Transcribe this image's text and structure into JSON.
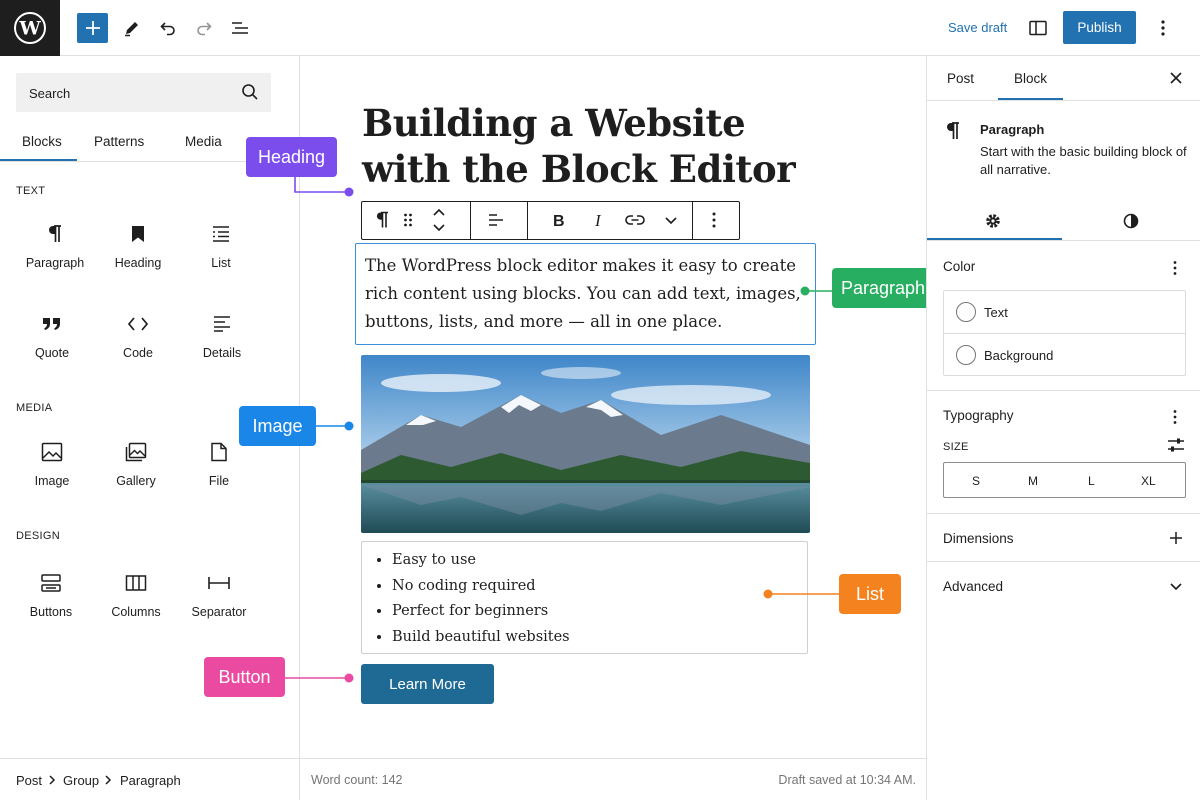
{
  "toolbar": {
    "save_draft": "Save draft",
    "publish": "Publish"
  },
  "inserter": {
    "search_placeholder": "Search",
    "tabs": [
      "Blocks",
      "Patterns",
      "Media"
    ],
    "categories": {
      "text": {
        "label": "TEXT",
        "blocks": [
          {
            "label": "Paragraph",
            "icon": "pilcrow-icon"
          },
          {
            "label": "Heading",
            "icon": "bookmark-icon"
          },
          {
            "label": "List",
            "icon": "list-icon"
          },
          {
            "label": "Quote",
            "icon": "quote-icon"
          },
          {
            "label": "Code",
            "icon": "code-icon"
          },
          {
            "label": "Details",
            "icon": "details-icon"
          }
        ]
      },
      "media": {
        "label": "MEDIA",
        "blocks": [
          {
            "label": "Image",
            "icon": "image-icon"
          },
          {
            "label": "Gallery",
            "icon": "gallery-icon"
          },
          {
            "label": "File",
            "icon": "file-icon"
          }
        ]
      },
      "design": {
        "label": "DESIGN",
        "blocks": [
          {
            "label": "Buttons",
            "icon": "buttons-icon"
          },
          {
            "label": "Columns",
            "icon": "columns-icon"
          },
          {
            "label": "Separator",
            "icon": "separator-icon"
          }
        ]
      }
    }
  },
  "breadcrumb": [
    "Post",
    "Group",
    "Paragraph"
  ],
  "post": {
    "title": "Building a Website with the Block Editor",
    "paragraph": "The WordPress block editor makes it easy to create rich content using blocks. You can add text, images, buttons, lists, and more — all in one place.",
    "list_items": [
      "Easy to use",
      "No coding required",
      "Perfect for beginners",
      "Build beautiful websites"
    ],
    "button_label": "Learn More"
  },
  "callouts": {
    "heading": "Heading",
    "paragraph": "Paragraph",
    "image": "Image",
    "list": "List",
    "button": "Button"
  },
  "status": {
    "word_count": "Word count: 142",
    "draft_saved": "Draft saved at 10:34 AM."
  },
  "settings": {
    "tabs": [
      "Post",
      "Block"
    ],
    "block_name": "Paragraph",
    "block_description": "Start with the basic building block of all narrative.",
    "color": {
      "title": "Color",
      "options": [
        "Text",
        "Background"
      ]
    },
    "typography": {
      "title": "Typography",
      "size_label": "SIZE",
      "sizes": [
        "S",
        "M",
        "L",
        "XL"
      ]
    },
    "dimensions": "Dimensions",
    "advanced": "Advanced"
  },
  "colors": {
    "accent": "#2271b1",
    "heading_callout": "#7c4ded",
    "paragraph_callout": "#27ae60",
    "image_callout": "#1a86e8",
    "list_callout": "#f4821f",
    "button_callout": "#ea4aa0",
    "cta_button": "#1f6a94"
  }
}
